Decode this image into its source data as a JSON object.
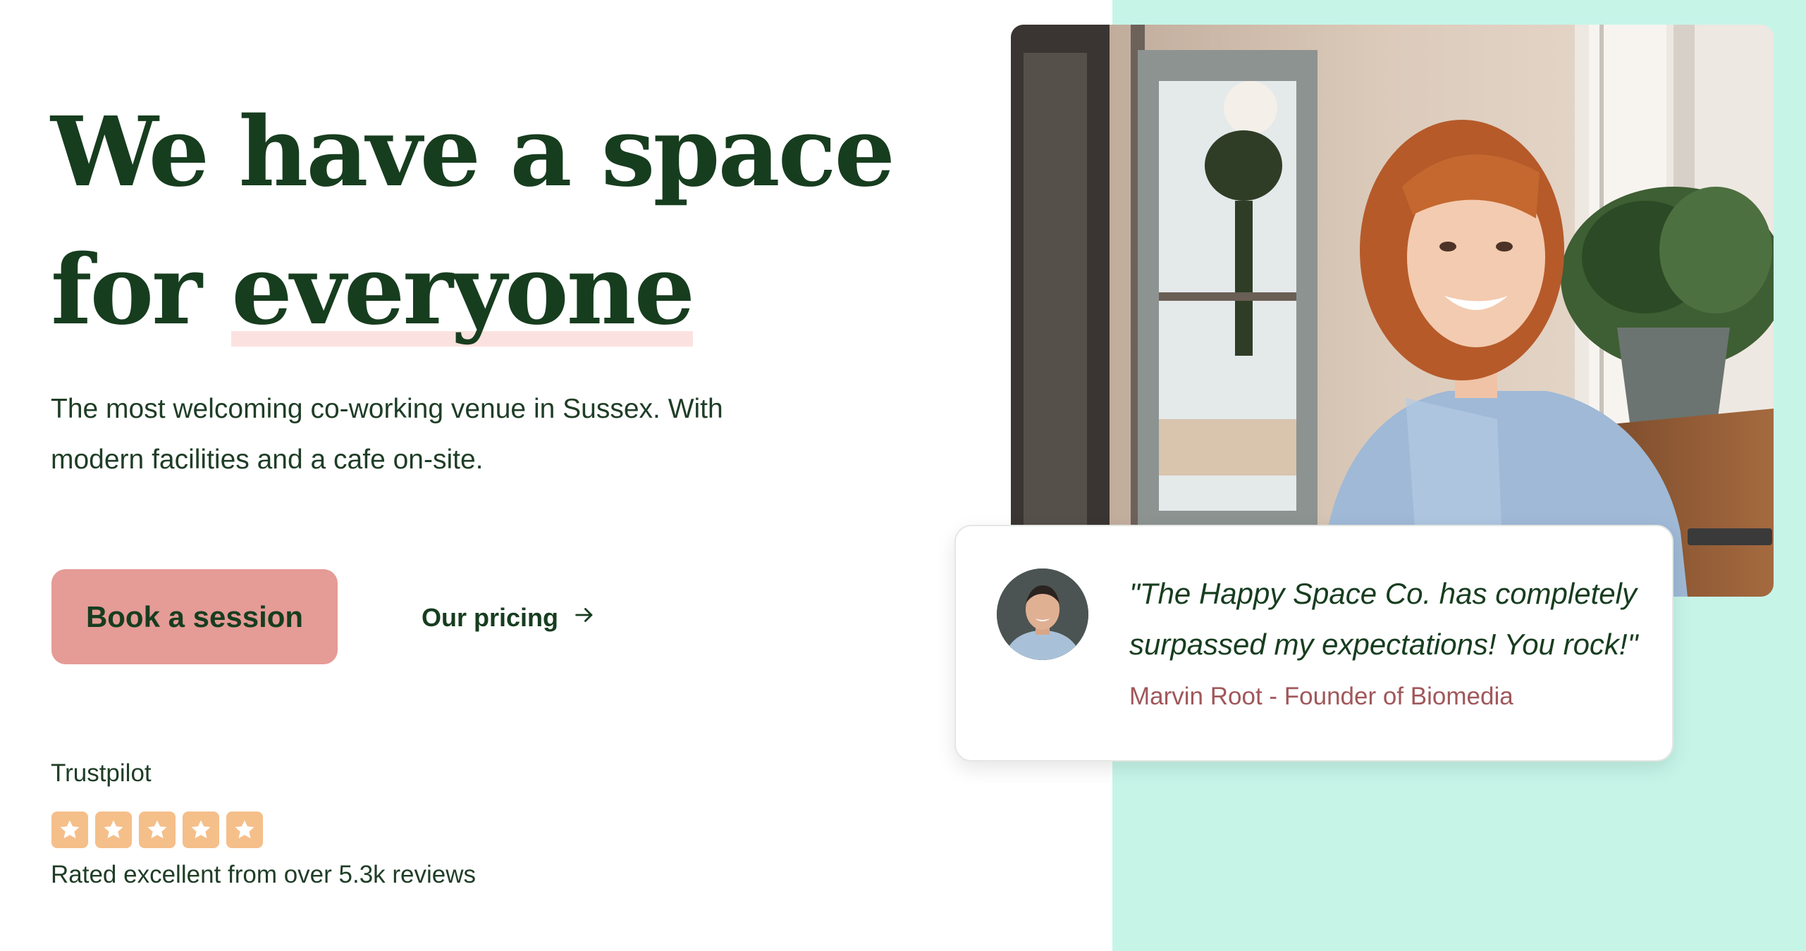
{
  "hero": {
    "title_line1": "We have a space",
    "title_line2_prefix": "for ",
    "title_highlight": "everyone",
    "subtitle": "The most welcoming co-working venue in Sussex. With modern facilities and a cafe on-site."
  },
  "actions": {
    "primary_label": "Book a session",
    "secondary_label": "Our pricing"
  },
  "rating": {
    "provider": "Trustpilot",
    "stars": 5,
    "summary": "Rated excellent from over 5.3k reviews"
  },
  "testimonial": {
    "quote": "\"The Happy Space Co. has completely surpassed my expectations! You rock!\"",
    "author": "Marvin Root - Founder of Biomedia"
  },
  "icons": {
    "pricing_link": "arrow-right-icon",
    "star": "star-icon"
  },
  "colors": {
    "heading": "#173d1f",
    "accent_button": "#e59b96",
    "mint_background": "#c6f5e8",
    "star_box": "#f5bf8a",
    "author": "#a0575a",
    "highlight": "#fbe2e0"
  }
}
